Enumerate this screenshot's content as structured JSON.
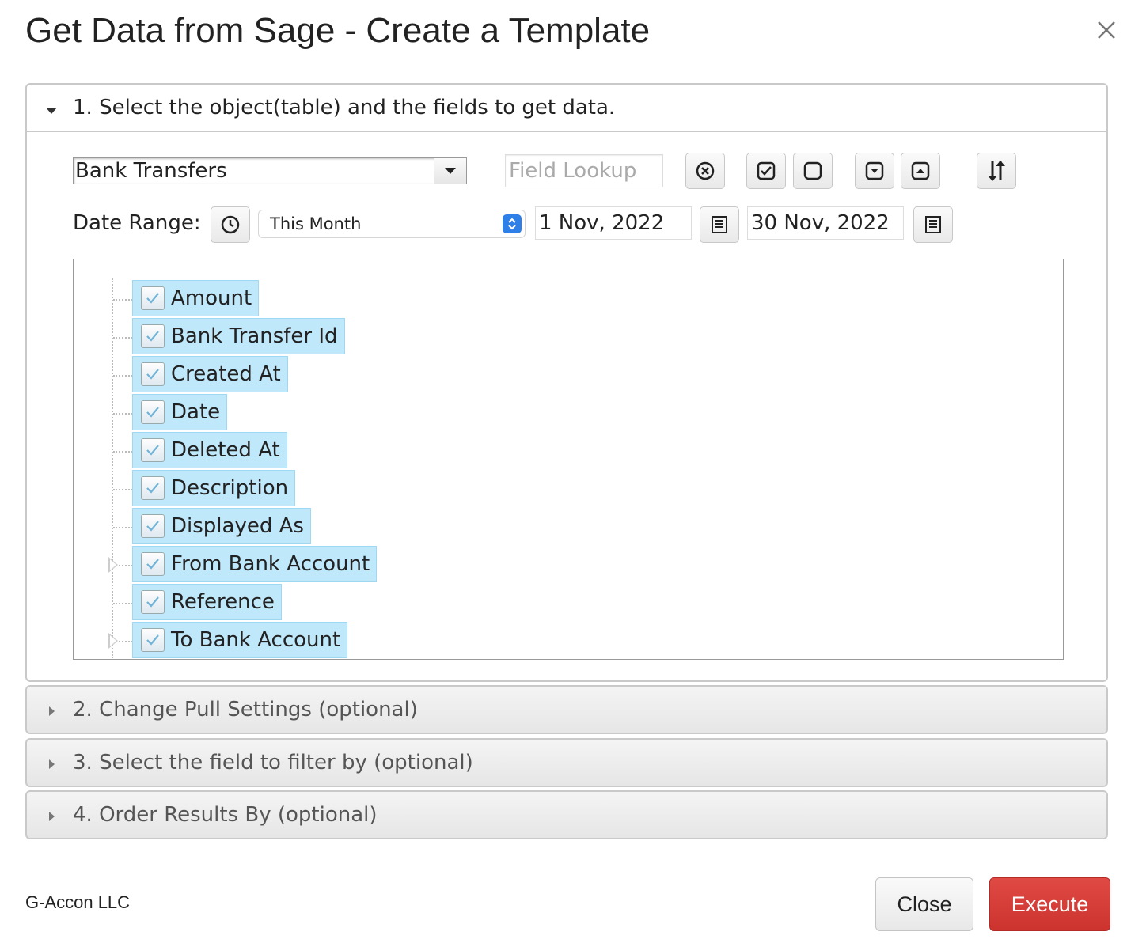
{
  "dialog": {
    "title": "Get Data from Sage - Create a Template",
    "close_icon": "close-icon"
  },
  "sections": [
    {
      "label": "1. Select the object(table) and the fields to get data.",
      "expanded": true
    },
    {
      "label": "2. Change Pull Settings (optional)",
      "expanded": false
    },
    {
      "label": "3. Select the field to filter by (optional)",
      "expanded": false
    },
    {
      "label": "4. Order Results By (optional)",
      "expanded": false
    }
  ],
  "object_select": {
    "value": "Bank Transfers"
  },
  "field_lookup": {
    "placeholder": "Field Lookup"
  },
  "toolbar_icons": [
    "clear-icon",
    "check-all-icon",
    "uncheck-all-icon",
    "expand-all-icon",
    "collapse-all-icon",
    "sort-icon"
  ],
  "date_range": {
    "label": "Date Range:",
    "preset": "This Month",
    "from": "1 Nov, 2022",
    "to": "30 Nov, 2022"
  },
  "fields": [
    {
      "label": "Amount",
      "checked": true,
      "expandable": false
    },
    {
      "label": "Bank Transfer Id",
      "checked": true,
      "expandable": false
    },
    {
      "label": "Created At",
      "checked": true,
      "expandable": false
    },
    {
      "label": "Date",
      "checked": true,
      "expandable": false
    },
    {
      "label": "Deleted At",
      "checked": true,
      "expandable": false
    },
    {
      "label": "Description",
      "checked": true,
      "expandable": false
    },
    {
      "label": "Displayed As",
      "checked": true,
      "expandable": false
    },
    {
      "label": "From Bank Account",
      "checked": true,
      "expandable": true
    },
    {
      "label": "Reference",
      "checked": true,
      "expandable": false
    },
    {
      "label": "To Bank Account",
      "checked": true,
      "expandable": true
    }
  ],
  "footer": {
    "brand": "G-Accon LLC",
    "close_label": "Close",
    "execute_label": "Execute"
  },
  "colors": {
    "chip_bg": "#bfe8fb",
    "execute_bg": "#d33a35",
    "stepper_blue": "#2f7fe8"
  }
}
